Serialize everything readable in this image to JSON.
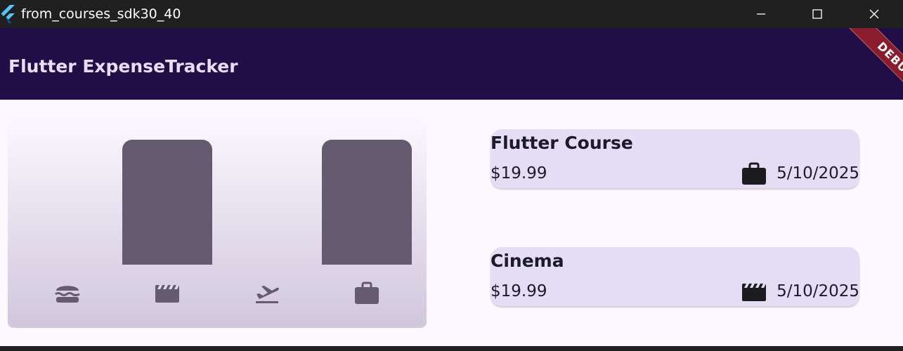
{
  "window": {
    "title": "from_courses_sdk30_40",
    "icons": [
      "flutter-logo-icon",
      "minimize-icon",
      "maximize-icon",
      "close-icon"
    ]
  },
  "appbar": {
    "title": "Flutter ExpenseTracker",
    "background": "#220e47",
    "debug_banner": "DEBUG"
  },
  "chart": {
    "bar_color": "#645b70",
    "categories": [
      {
        "name": "food",
        "icon": "burger-icon",
        "value": 0
      },
      {
        "name": "leisure",
        "icon": "movie-icon",
        "value": 1
      },
      {
        "name": "travel",
        "icon": "flight-takeoff-icon",
        "value": 0
      },
      {
        "name": "work",
        "icon": "briefcase-icon",
        "value": 1
      }
    ]
  },
  "expenses": [
    {
      "title": "Flutter Course",
      "amount": "$19.99",
      "icon": "briefcase-icon",
      "date": "5/10/2025"
    },
    {
      "title": "Cinema",
      "amount": "$19.99",
      "icon": "movie-icon",
      "date": "5/10/2025"
    }
  ]
}
